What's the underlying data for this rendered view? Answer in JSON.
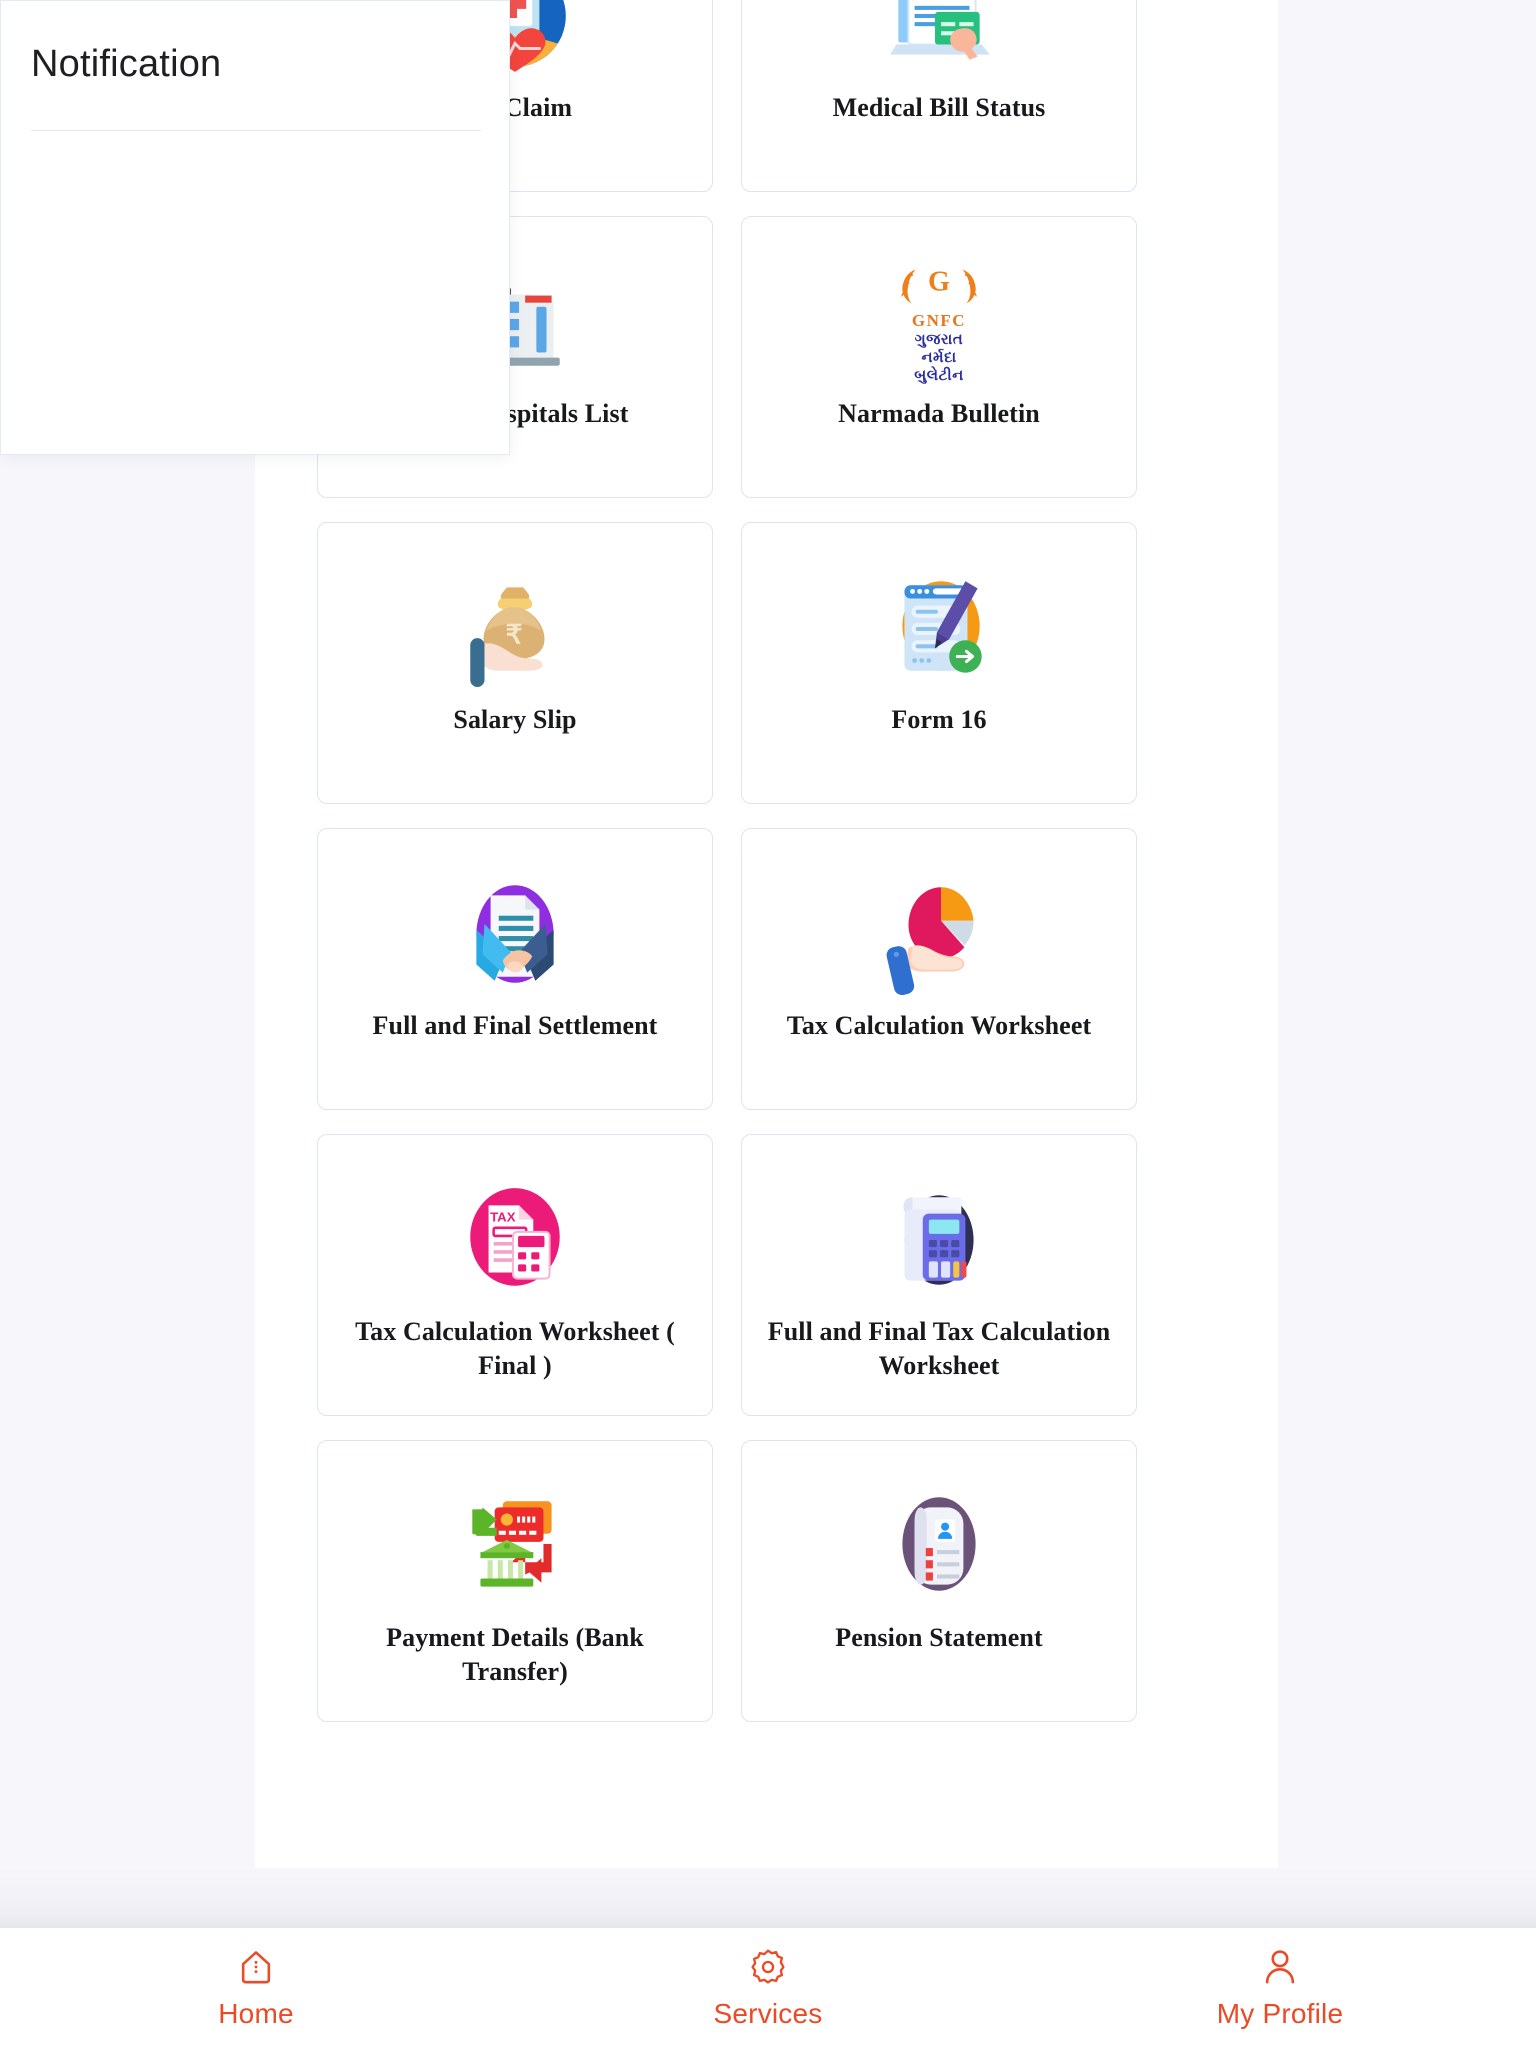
{
  "app": {
    "background_color": "#f7f7fb",
    "panel_color": "#ffffff",
    "card_border_color": "#dfe3f3",
    "accent_color": "#ea4a26"
  },
  "notification": {
    "title": "Notification",
    "body_text": ""
  },
  "services_grid": {
    "cards": [
      {
        "label": "Bill Claim",
        "icon": "medical-bill-claim-icon"
      },
      {
        "label": "Medical Bill Status",
        "icon": "medical-bill-status-icon"
      },
      {
        "label": "Tieup Hospitals List",
        "icon": "hospital-building-icon"
      },
      {
        "label": "Narmada Bulletin",
        "icon": "gnfc-logo-icon"
      },
      {
        "label": "Salary Slip",
        "icon": "money-bag-hand-icon"
      },
      {
        "label": "Form 16",
        "icon": "form-pen-icon"
      },
      {
        "label": "Full and Final Settlement",
        "icon": "handshake-document-icon"
      },
      {
        "label": "Tax Calculation Worksheet",
        "icon": "pie-chart-hand-icon"
      },
      {
        "label": "Tax Calculation Worksheet ( Final )",
        "icon": "tax-calculator-icon"
      },
      {
        "label": "Full and Final Tax Calculation Worksheet",
        "icon": "calculator-receipt-icon"
      },
      {
        "label": "Payment Details (Bank Transfer)",
        "icon": "bank-transfer-icon"
      },
      {
        "label": "Pension Statement",
        "icon": "pension-id-card-icon"
      }
    ]
  },
  "gnfc_logo": {
    "letter": "G",
    "word": "GNFC",
    "gujarati_line1": "ગુજરાત",
    "gujarati_line2": "નર્મદા",
    "gujarati_line3": "બુલેટીન"
  },
  "tax_icon": {
    "label": "TAX"
  },
  "bottom_nav": {
    "items": [
      {
        "label": "Home",
        "icon": "home-icon",
        "active": true
      },
      {
        "label": "Services",
        "icon": "gear-icon",
        "active": false
      },
      {
        "label": "My Profile",
        "icon": "person-icon",
        "active": false
      }
    ]
  }
}
